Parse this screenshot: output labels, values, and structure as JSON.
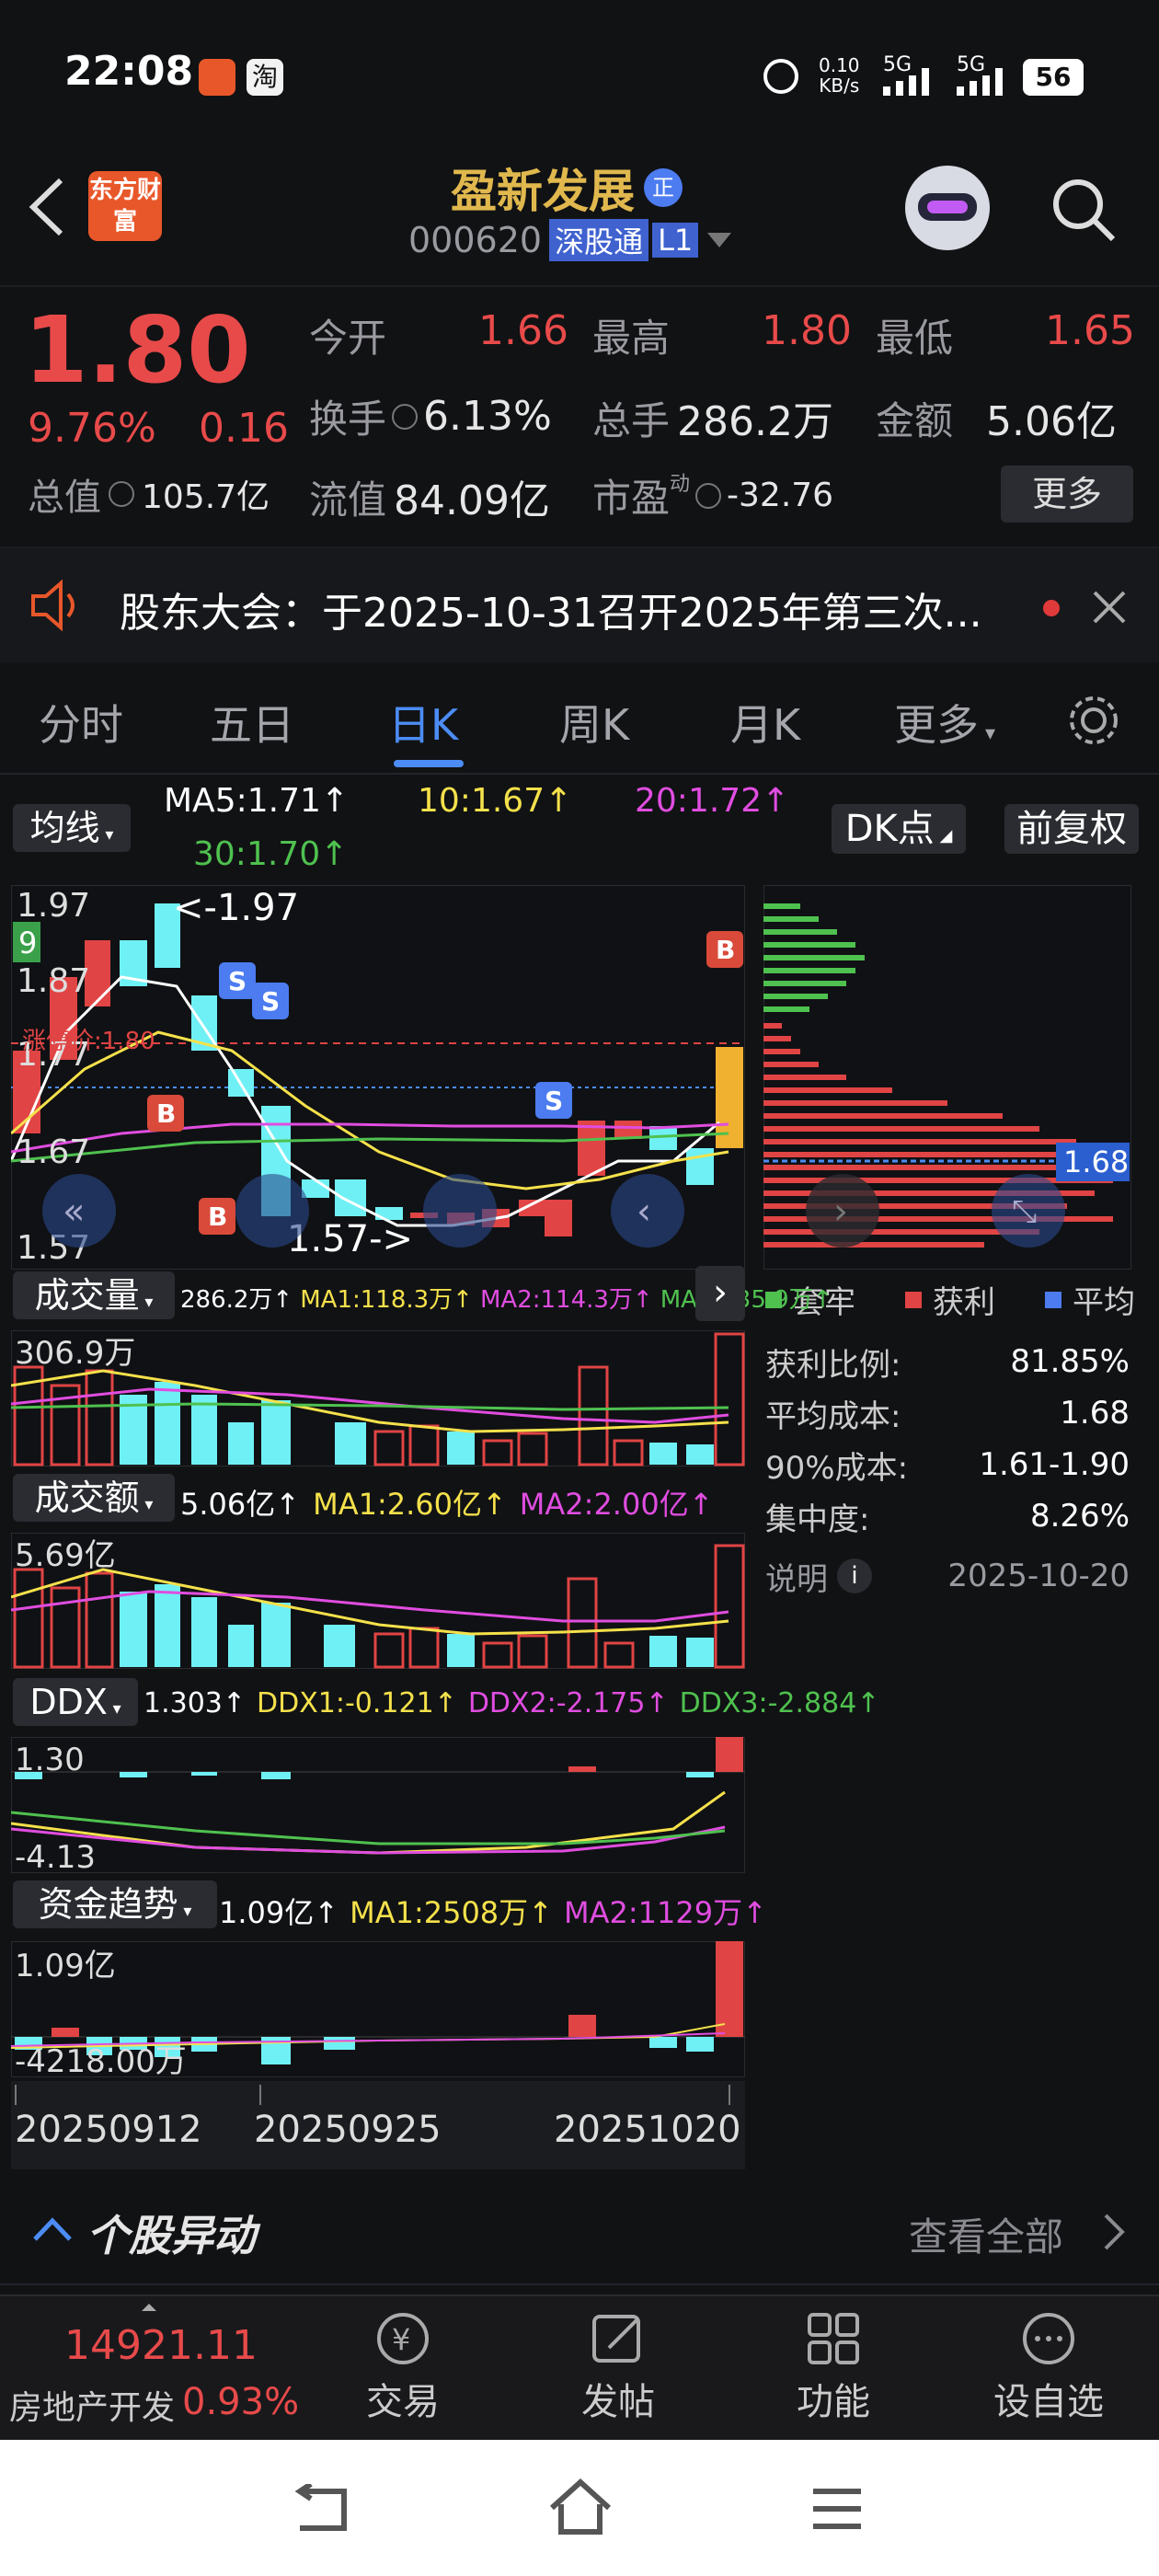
{
  "status": {
    "time": "22:08",
    "speed_value": "0.10",
    "speed_unit": "KB/s",
    "sim1": "5G",
    "sim2": "5G",
    "battery": "56"
  },
  "header": {
    "brand_logo_text": "东方财富",
    "stock_name": "盈新发展",
    "stock_badge": "正",
    "stock_code": "000620",
    "market_tag": "深股通",
    "level_tag": "L1"
  },
  "quote": {
    "price": "1.80",
    "change_pct": "9.76%",
    "change_abs": "0.16",
    "open_label": "今开",
    "open_value": "1.66",
    "high_label": "最高",
    "high_value": "1.80",
    "low_label": "最低",
    "low_value": "1.65",
    "turnover_label": "换手",
    "turnover_value": "6.13%",
    "volume_label": "总手",
    "volume_value": "286.2万",
    "amount_label": "金额",
    "amount_value": "5.06亿",
    "mktcap_label": "总值",
    "mktcap_value": "105.7亿",
    "float_label": "流值",
    "float_value": "84.09亿",
    "pe_label": "市盈",
    "pe_sup": "动",
    "pe_value": "-32.76",
    "more_button": "更多"
  },
  "notice": {
    "text": "股东大会：于2025-10-31召开2025年第三次..."
  },
  "tabs": [
    "分时",
    "五日",
    "日K",
    "周K",
    "月K",
    "更多"
  ],
  "active_tab_index": 2,
  "kline": {
    "indicator_select": "均线",
    "ma5": "MA5:1.71↑",
    "ma10": "10:1.67↑",
    "ma20": "20:1.72↑",
    "ma30": "30:1.70↑",
    "dk_button": "DK点",
    "adjust_button": "前复权",
    "price_ticks": [
      "1.97",
      "1.87",
      "1.77",
      "1.67",
      "1.57"
    ],
    "max_label": "<-1.97",
    "min_label": "1.57->",
    "limit_label": "涨停价:1.80",
    "badge_9": "9",
    "colors": {
      "up": "#e04444",
      "down": "#6ff0f4",
      "ma5": "#ffffff",
      "ma10": "#f5e14b",
      "ma20": "#e04de0",
      "ma30": "#4fc14f"
    }
  },
  "chip": {
    "avg_price_tag": "1.68",
    "legend": [
      "套牢",
      "获利",
      "平均"
    ],
    "profit_ratio_label": "获利比例:",
    "profit_ratio_value": "81.85%",
    "avg_cost_label": "平均成本:",
    "avg_cost_value": "1.68",
    "cost90_label": "90%成本:",
    "cost90_value": "1.61-1.90",
    "concentration_label": "集中度:",
    "concentration_value": "8.26%",
    "note_label": "说明",
    "date": "2025-10-20"
  },
  "volume": {
    "title": "成交量",
    "val": "286.2万↑",
    "ma1": "MA1:118.3万↑",
    "ma2": "MA2:114.3万↑",
    "ma3": "MA3:135.9万↑",
    "axis_max": "306.9万"
  },
  "amount": {
    "title": "成交额",
    "val": "5.06亿↑",
    "ma1": "MA1:2.60亿↑",
    "ma2": "MA2:2.00亿↑",
    "axis_max": "5.69亿"
  },
  "ddx": {
    "title": "DDX",
    "val": "1.303↑",
    "ddx1": "DDX1:-0.121↑",
    "ddx2": "DDX2:-2.175↑",
    "ddx3": "DDX3:-2.884↑",
    "axis_max": "1.30",
    "axis_min": "-4.13"
  },
  "fund": {
    "title": "资金趋势",
    "val": "1.09亿↑",
    "ma1": "MA1:2508万↑",
    "ma2": "MA2:1129万↑",
    "axis_max": "1.09亿",
    "axis_min": "-4218.00万"
  },
  "dates": [
    "20250912",
    "20250925",
    "20251020"
  ],
  "movement": {
    "title": "个股异动",
    "view_all": "查看全部"
  },
  "bottom": {
    "index_value": "14921.11",
    "index_name": "房地产开发",
    "index_pct": "0.93%",
    "items": [
      "交易",
      "发帖",
      "功能",
      "设自选"
    ]
  }
}
